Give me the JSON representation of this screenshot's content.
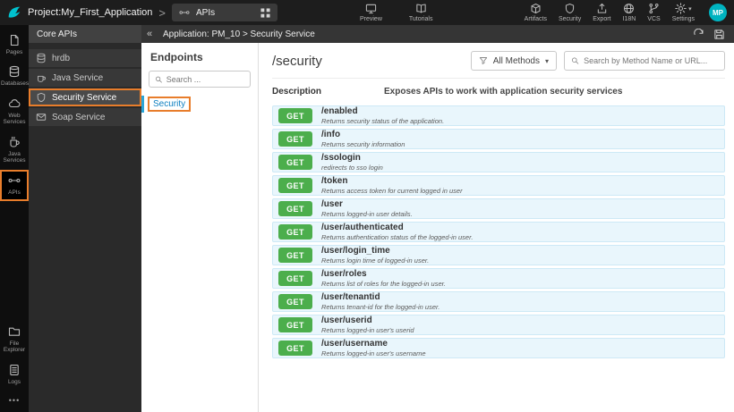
{
  "topbar": {
    "project_label": "Project:My_First_Application",
    "apis_pill_label": "APIs",
    "center_items": [
      {
        "label": "Preview"
      },
      {
        "label": "Tutorials"
      }
    ],
    "right_items": [
      {
        "label": "Artifacts"
      },
      {
        "label": "Security"
      },
      {
        "label": "Export"
      },
      {
        "label": "I18N"
      },
      {
        "label": "VCS"
      },
      {
        "label": "Settings"
      }
    ],
    "avatar_initials": "MP"
  },
  "sidebar": {
    "items": [
      {
        "label": "Pages"
      },
      {
        "label": "Databases"
      },
      {
        "label": "Web Services"
      },
      {
        "label": "Java Services"
      },
      {
        "label": "APIs",
        "active": true
      }
    ],
    "bottom_items": [
      {
        "label": "File Explorer"
      },
      {
        "label": "Logs"
      }
    ]
  },
  "core_panel": {
    "title": "Core APIs",
    "items": [
      {
        "label": "hrdb"
      },
      {
        "label": "Java Service"
      },
      {
        "label": "Security Service",
        "selected": true
      },
      {
        "label": "Soap Service"
      }
    ]
  },
  "content_header": {
    "breadcrumb": "Application: PM_10 > Security Service"
  },
  "endpoints_panel": {
    "title": "Endpoints",
    "search_placeholder": "Search ...",
    "items": [
      {
        "label": "Security",
        "selected": true
      }
    ]
  },
  "main": {
    "title": "/security",
    "methods_filter_label": "All Methods",
    "search_placeholder": "Search by Method Name or URL...",
    "description_label": "Description",
    "description_text": "Exposes APIs to work with application security services",
    "endpoints": [
      {
        "method": "GET",
        "path": "/enabled",
        "description": "Returns security status of the application."
      },
      {
        "method": "GET",
        "path": "/info",
        "description": "Returns security information"
      },
      {
        "method": "GET",
        "path": "/ssologin",
        "description": "redirects to sso login"
      },
      {
        "method": "GET",
        "path": "/token",
        "description": "Returns access token for current logged in user"
      },
      {
        "method": "GET",
        "path": "/user",
        "description": "Returns logged-in user details."
      },
      {
        "method": "GET",
        "path": "/user/authenticated",
        "description": "Returns authentication status of the logged-in user."
      },
      {
        "method": "GET",
        "path": "/user/login_time",
        "description": "Returns login time of logged-in user."
      },
      {
        "method": "GET",
        "path": "/user/roles",
        "description": "Returns list of roles for the logged-in user."
      },
      {
        "method": "GET",
        "path": "/user/tenantid",
        "description": "Returns tenant-id for the logged-in user."
      },
      {
        "method": "GET",
        "path": "/user/userid",
        "description": "Returns logged-in user's userid"
      },
      {
        "method": "GET",
        "path": "/user/username",
        "description": "Returns logged-in user's username"
      }
    ]
  },
  "icons": {
    "chevron_right": ">",
    "collapse_left": "«",
    "caret_down": "▾",
    "more_horizontal": "•••"
  },
  "colors": {
    "accent_teal": "#00b3c0",
    "get_green": "#4cae4c",
    "annotation_orange": "#e87d2b",
    "endpoint_row_blue": "#e9f6fc",
    "topbar_dark": "#1d1d1d"
  }
}
